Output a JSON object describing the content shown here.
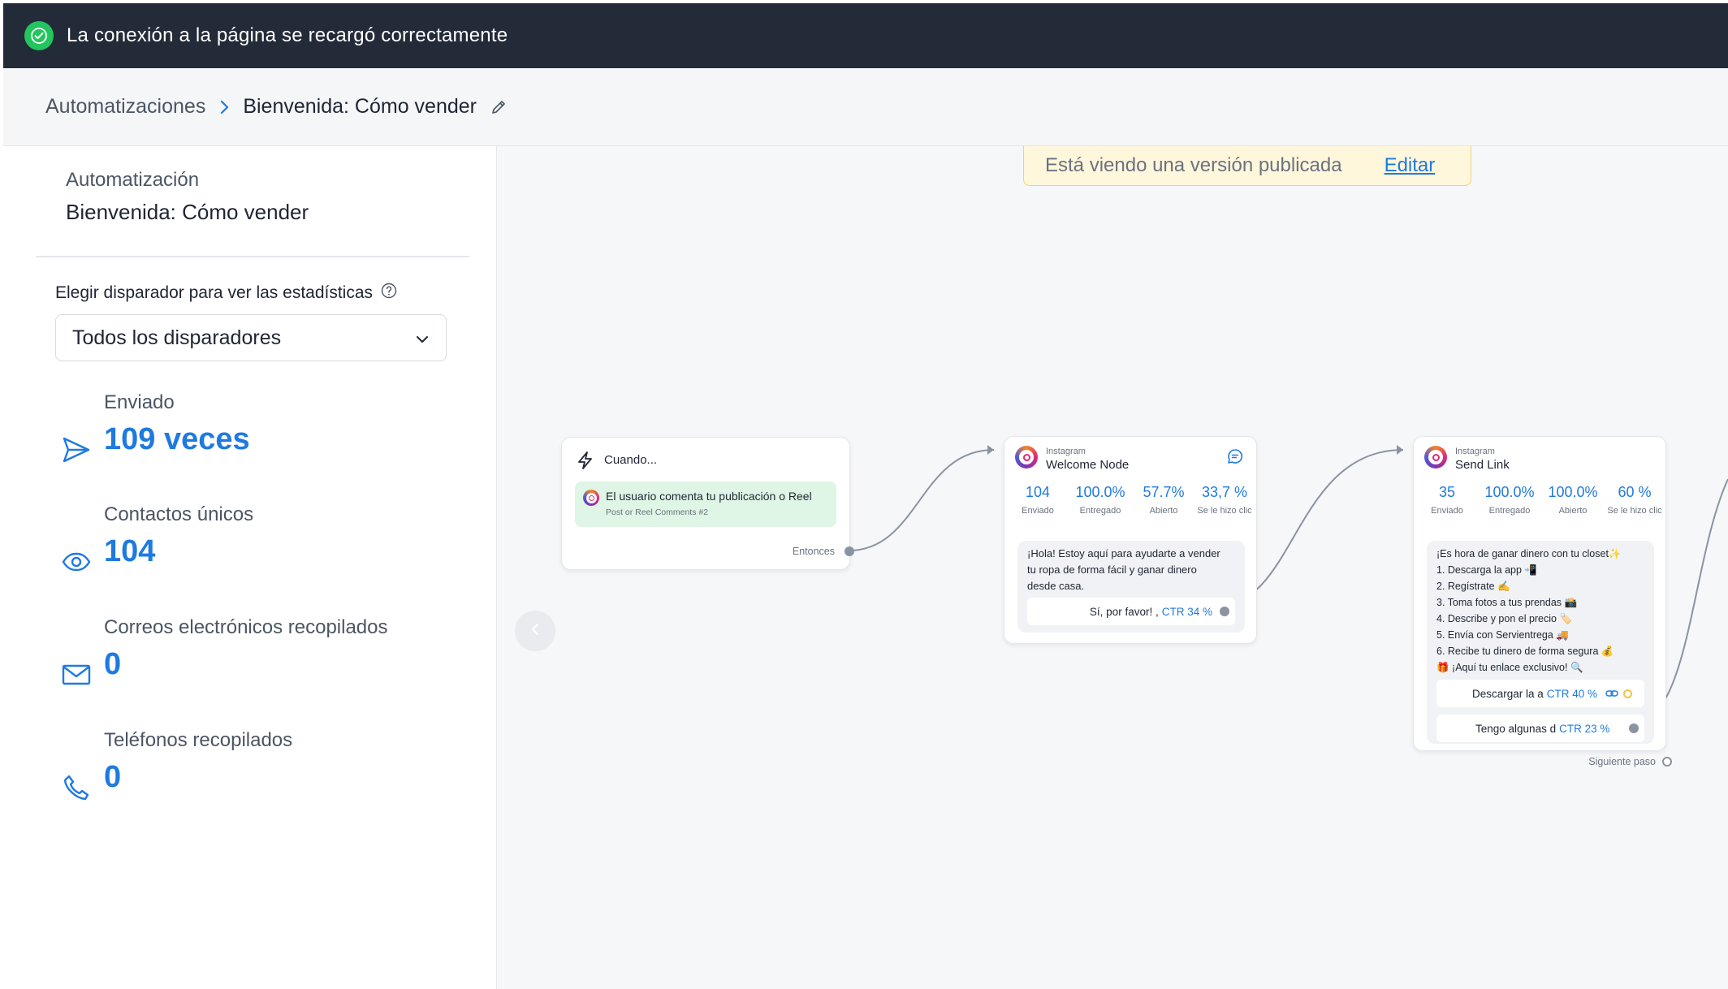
{
  "banner": {
    "message": "La conexión a la página se recargó correctamente"
  },
  "breadcrumb": {
    "parent": "Automatizaciones",
    "current": "Bienvenida: Cómo vender"
  },
  "sidebar": {
    "caption": "Automatización",
    "name": "Bienvenida: Cómo vender",
    "trigger_label": "Elegir disparador para ver las estadísticas",
    "trigger_value": "Todos los disparadores",
    "stats": [
      {
        "label": "Enviado",
        "value": "109 veces",
        "icon": "send-icon"
      },
      {
        "label": "Contactos únicos",
        "value": "104",
        "icon": "eye-icon"
      },
      {
        "label": "Correos electrónicos recopilados",
        "value": "0",
        "icon": "mail-icon"
      },
      {
        "label": "Teléfonos recopilados",
        "value": "0",
        "icon": "phone-icon"
      }
    ]
  },
  "canvas": {
    "published_notice": "Está viendo una versión publicada",
    "edit_label": "Editar",
    "trigger_node": {
      "title": "Cuando...",
      "event": "El usuario comenta tu publicación o Reel",
      "event_sub": "Post or Reel Comments #2",
      "then_label": "Entonces"
    },
    "welcome_node": {
      "platform": "Instagram",
      "title": "Welcome Node",
      "metrics": [
        {
          "value": "104",
          "label": "Enviado"
        },
        {
          "value": "100.0%",
          "label": "Entregado"
        },
        {
          "value": "57.7%",
          "label": "Abierto"
        },
        {
          "value": "33,7 %",
          "label": "Se le hizo clic"
        }
      ],
      "message": [
        "¡Hola! Estoy aquí para ayudarte a vender",
        "tu ropa de forma fácil y ganar dinero",
        "desde casa."
      ],
      "button_text": "Sí, por favor! ,",
      "button_ctr": "CTR 34 %"
    },
    "sendlink_node": {
      "platform": "Instagram",
      "title": "Send Link",
      "metrics": [
        {
          "value": "35",
          "label": "Enviado"
        },
        {
          "value": "100.0%",
          "label": "Entregado"
        },
        {
          "value": "100.0%",
          "label": "Abierto"
        },
        {
          "value": "60 %",
          "label": "Se le hizo clic"
        }
      ],
      "message": [
        "¡Es hora de ganar dinero con tu closet✨",
        "1. Descarga la app 📲",
        "2. Regístrate ✍️",
        "3. Toma fotos a tus prendas 📸",
        "4. Describe y pon el precio 🏷️",
        "5. Envía con Servientrega 🚚",
        "6. Recibe tu dinero de forma segura 💰",
        "🎁 ¡Aquí tu enlace exclusivo! 🔍"
      ],
      "buttons": [
        {
          "text": "Descargar la a",
          "ctr": "CTR 40 %"
        },
        {
          "text": "Tengo algunas d",
          "ctr": "CTR 23 %"
        }
      ],
      "next_label": "Siguiente paso"
    }
  },
  "colors": {
    "accent": "#1f7ae0",
    "banner_bg": "#232b39",
    "success": "#22c55e"
  }
}
